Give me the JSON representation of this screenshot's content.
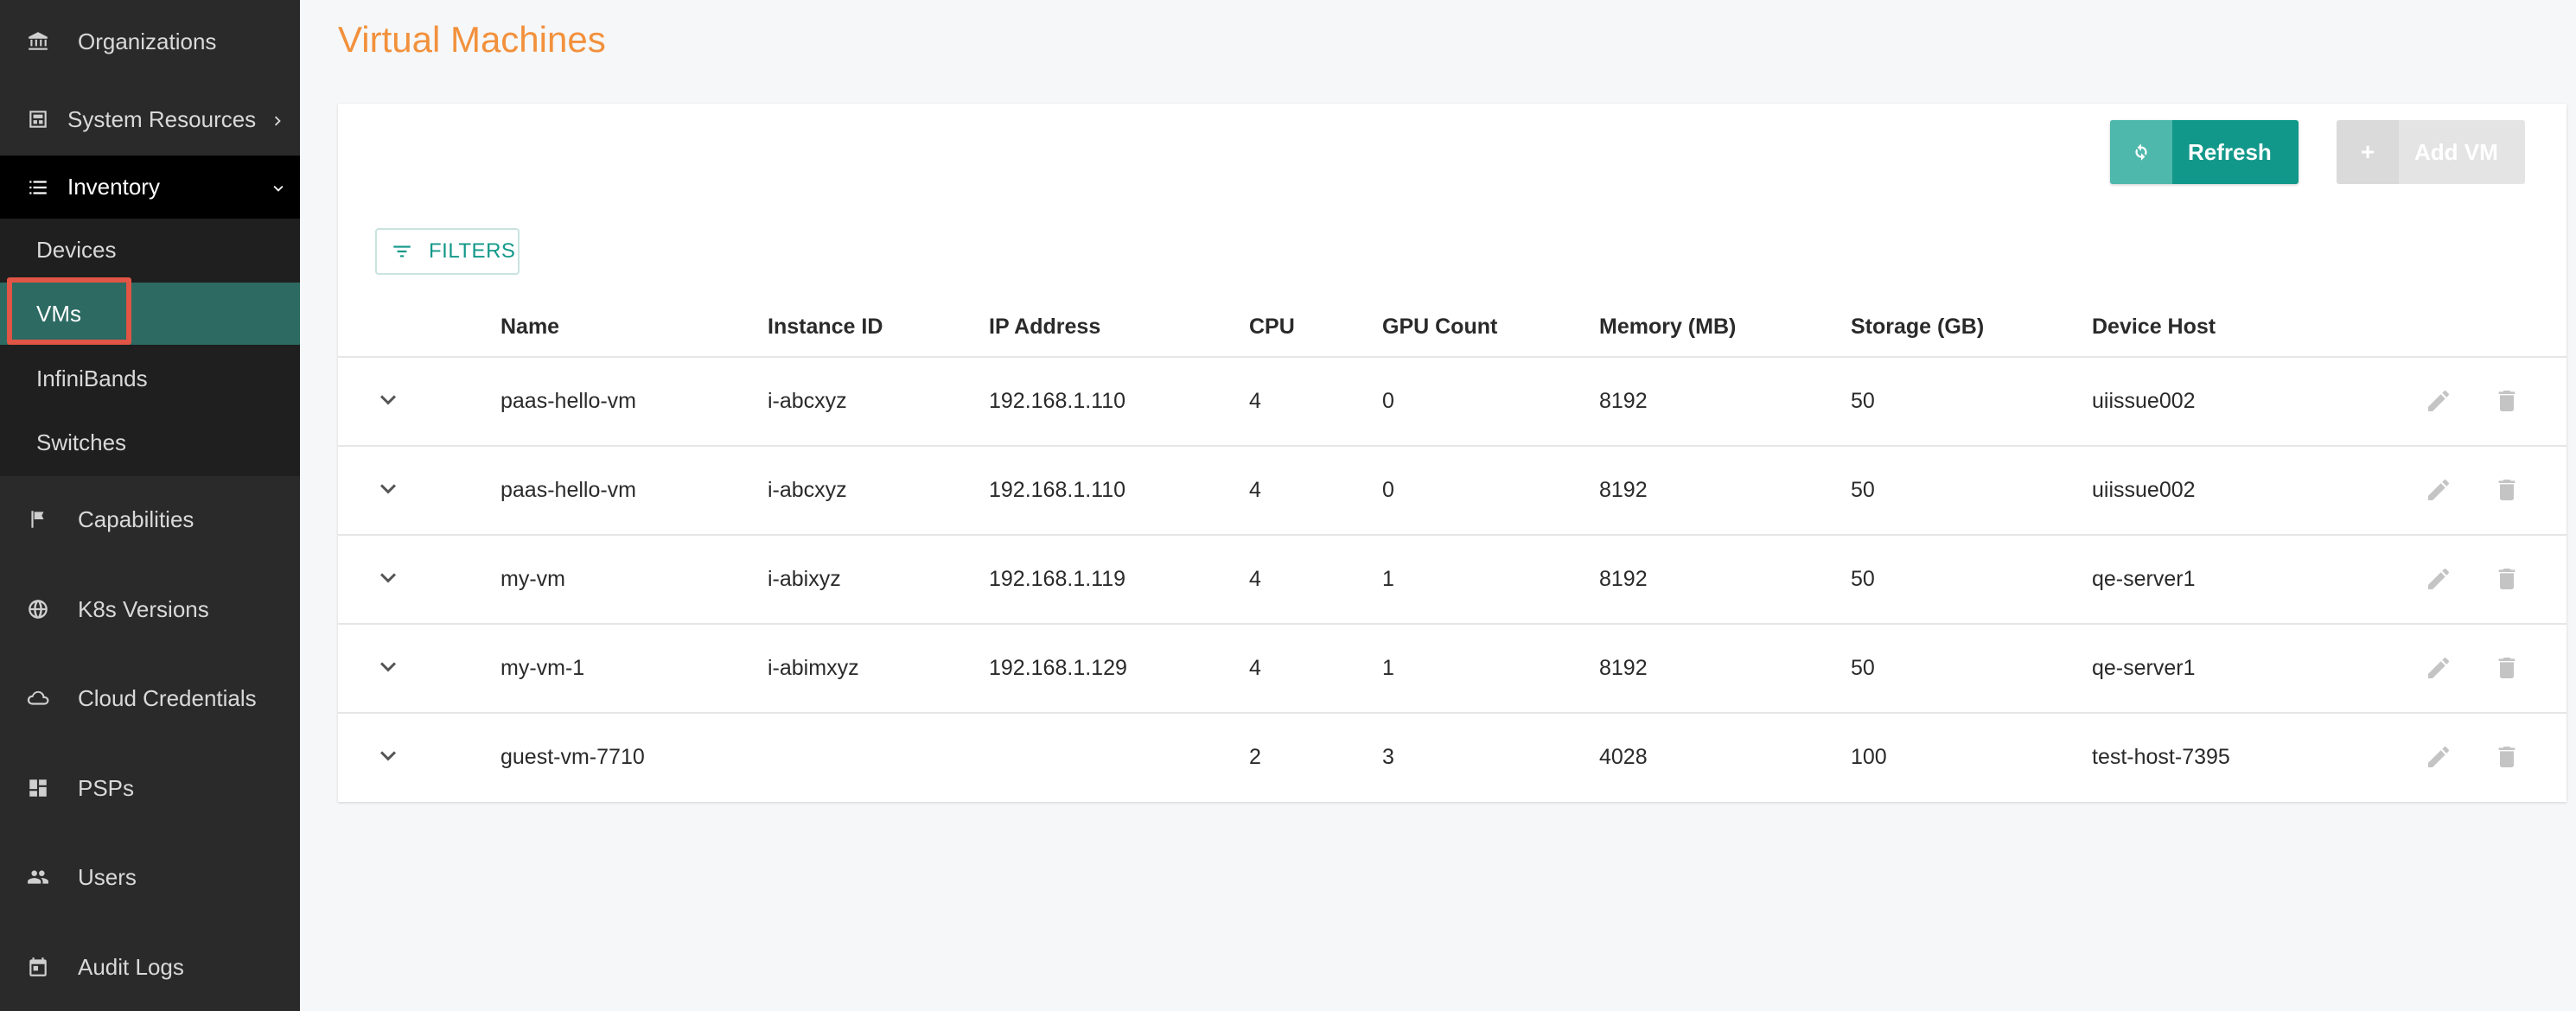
{
  "sidebar": {
    "organizations": "Organizations",
    "system_resources": "System Resources",
    "inventory": "Inventory",
    "sub_items": [
      "Devices",
      "VMs",
      "InfiniBands",
      "Switches"
    ],
    "capabilities": "Capabilities",
    "k8s_versions": "K8s Versions",
    "cloud_credentials": "Cloud Credentials",
    "psps": "PSPs",
    "users": "Users",
    "audit_logs": "Audit Logs"
  },
  "page": {
    "title": "Virtual Machines"
  },
  "toolbar": {
    "refresh_label": "Refresh",
    "add_label": "Add VM",
    "filters_label": "FILTERS"
  },
  "table": {
    "columns": [
      "Name",
      "Instance ID",
      "IP Address",
      "CPU",
      "GPU Count",
      "Memory (MB)",
      "Storage (GB)",
      "Device Host"
    ],
    "rows": [
      [
        "paas-hello-vm",
        "i-abcxyz",
        "192.168.1.110",
        "4",
        "0",
        "8192",
        "50",
        "uiissue002"
      ],
      [
        "paas-hello-vm",
        "i-abcxyz",
        "192.168.1.110",
        "4",
        "0",
        "8192",
        "50",
        "uiissue002"
      ],
      [
        "my-vm",
        "i-abixyz",
        "192.168.1.119",
        "4",
        "1",
        "8192",
        "50",
        "qe-server1"
      ],
      [
        "my-vm-1",
        "i-abimxyz",
        "192.168.1.129",
        "4",
        "1",
        "8192",
        "50",
        "qe-server1"
      ],
      [
        "guest-vm-7710",
        "",
        "",
        "2",
        "3",
        "4028",
        "100",
        "test-host-7395"
      ]
    ]
  },
  "colors": {
    "accent": "#12988a",
    "title": "#f2913c",
    "sidebar_bg": "#2a2a2a",
    "active_sub": "#2c6a62",
    "highlight": "#e05545"
  }
}
